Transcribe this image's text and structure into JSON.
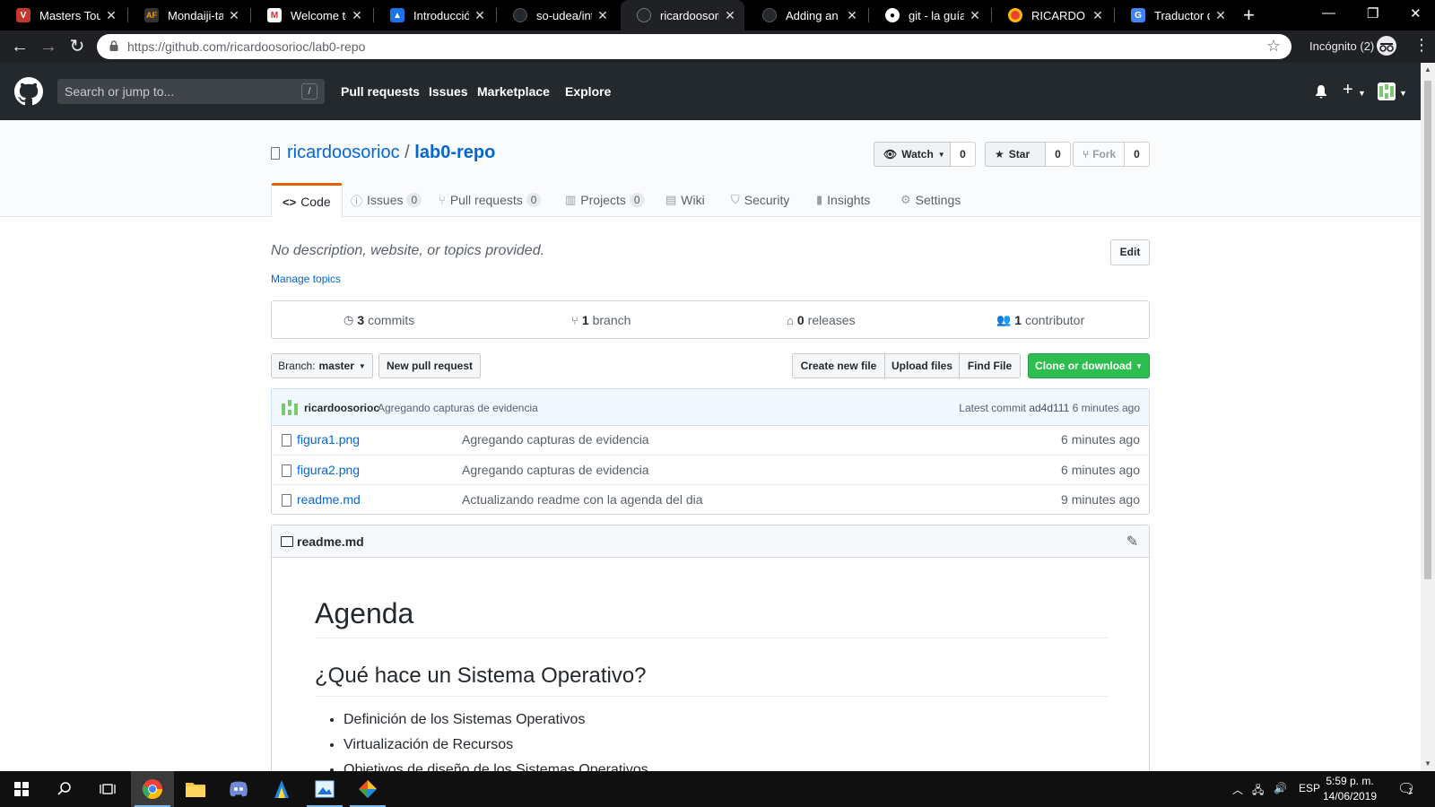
{
  "browser": {
    "tabs": [
      {
        "title": "Masters Tour",
        "favicon_color": "#c0392b",
        "favicon_glyph": "V"
      },
      {
        "title": "Mondaiji-tach",
        "favicon_color": "#333333",
        "favicon_glyph": "AF"
      },
      {
        "title": "Welcome to S",
        "favicon_color": "#d93025",
        "favicon_glyph": "M"
      },
      {
        "title": "Introducción",
        "favicon_color": "#1a73e8",
        "favicon_glyph": "i"
      },
      {
        "title": "so-udea/intre",
        "favicon_color": "#24292e",
        "favicon_glyph": "●"
      },
      {
        "title": "ricardoosorio",
        "favicon_color": "#24292e",
        "favicon_glyph": "●"
      },
      {
        "title": "Adding an ex",
        "favicon_color": "#24292e",
        "favicon_glyph": "●"
      },
      {
        "title": "git - la guía s",
        "favicon_color": "#ffffff",
        "favicon_glyph": "●"
      },
      {
        "title": "RICARDO OS",
        "favicon_color": "#4285f4",
        "favicon_glyph": "◉"
      },
      {
        "title": "Traductor de",
        "favicon_color": "#4285f4",
        "favicon_glyph": "G"
      }
    ],
    "url": "https://github.com/ricardoosorioc/lab0-repo",
    "incognito_label": "Incógnito (2)"
  },
  "github_header": {
    "search_placeholder": "Search or jump to...",
    "slash_key": "/",
    "nav": [
      "Pull requests",
      "Issues",
      "Marketplace",
      "Explore"
    ]
  },
  "repo": {
    "owner": "ricardoosorioc",
    "separator": "/",
    "name": "lab0-repo",
    "watch_label": "Watch",
    "watch_count": "0",
    "star_label": "Star",
    "star_count": "0",
    "fork_label": "Fork",
    "fork_count": "0",
    "tabs": [
      {
        "label": "Code",
        "icon": "code-icon",
        "glyph": "<>",
        "count": ""
      },
      {
        "label": "Issues",
        "icon": "issue-icon",
        "glyph": "ⓘ",
        "count": "0"
      },
      {
        "label": "Pull requests",
        "icon": "git-pull-request-icon",
        "glyph": "⑂",
        "count": "0"
      },
      {
        "label": "Projects",
        "icon": "project-icon",
        "glyph": "▥",
        "count": "0"
      },
      {
        "label": "Wiki",
        "icon": "book-icon",
        "glyph": "▤",
        "count": ""
      },
      {
        "label": "Security",
        "icon": "shield-icon",
        "glyph": "⛉",
        "count": ""
      },
      {
        "label": "Insights",
        "icon": "graph-icon",
        "glyph": "▮",
        "count": ""
      },
      {
        "label": "Settings",
        "icon": "gear-icon",
        "glyph": "⚙",
        "count": ""
      }
    ],
    "description": "No description, website, or topics provided.",
    "edit_label": "Edit",
    "manage_topics": "Manage topics",
    "numbers": {
      "commits_count": "3",
      "commits_label": "commits",
      "branch_count": "1",
      "branch_label": "branch",
      "releases_count": "0",
      "releases_label": "releases",
      "contributor_count": "1",
      "contributor_label": "contributor"
    },
    "branch_prefix": "Branch:",
    "branch_name": "master",
    "new_pull_request": "New pull request",
    "file_buttons": [
      "Create new file",
      "Upload files",
      "Find File"
    ],
    "clone_label": "Clone or download",
    "latest_commit": {
      "author": "ricardoosorioc",
      "message": "Agregando capturas de evidencia",
      "prefix": "Latest commit",
      "sha": "ad4d111",
      "age": "6 minutes ago"
    },
    "files": [
      {
        "name": "figura1.png",
        "message": "Agregando capturas de evidencia",
        "age": "6 minutes ago"
      },
      {
        "name": "figura2.png",
        "message": "Agregando capturas de evidencia",
        "age": "6 minutes ago"
      },
      {
        "name": "readme.md",
        "message": "Actualizando readme con la agenda del dia",
        "age": "9 minutes ago"
      }
    ],
    "readme": {
      "filename": "readme.md",
      "h1": "Agenda",
      "h2": "¿Qué hace un Sistema Operativo?",
      "items": [
        "Definición de los Sistemas Operativos",
        "Virtualización de Recursos",
        "Objetivos de diseño de los Sistemas Operativos"
      ]
    }
  },
  "taskbar": {
    "language": "ESP",
    "time": "5:59 p. m.",
    "date": "14/06/2019",
    "notification_count": "1"
  },
  "colors": {
    "link": "#0366d6",
    "header_bg": "#24292e",
    "clone_green": "#2cbe4e",
    "selected_tab_accent": "#e36209"
  }
}
